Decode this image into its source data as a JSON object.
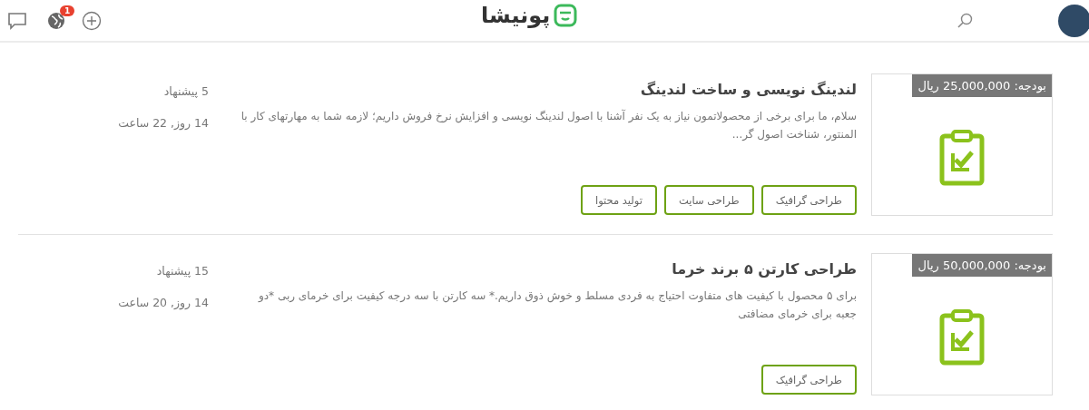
{
  "header": {
    "notification_count": "1",
    "logo": "پونیشا"
  },
  "projects": [
    {
      "budget": "بودجه: 25,000,000 ریال",
      "title": "لندینگ نویسی و ساخت لندینگ",
      "description": "سلام، ما برای برخی از محصولاتمون نیاز به یک نفر آشنا با اصول لندینگ نویسی و افزایش نرخ فروش داریم؛ لازمه شما به مهارتهای کار با المنتور، شناخت اصول گر...",
      "tags": [
        "طراحی گرافیک",
        "طراحی سایت",
        "تولید محتوا"
      ],
      "bids": "5 پیشنهاد",
      "time_left": "14 روز, 22 ساعت"
    },
    {
      "budget": "بودجه: 50,000,000 ریال",
      "title": "طراحی کارتن ۵ برند خرما",
      "description": "برای ۵ محصول با کیفیت های متفاوت احتیاج به فردی مسلط و خوش ذوق داریم.* سه کارتن با سه درجه کیفیت برای خرمای ربی *دو جعبه برای خرمای مضافتی",
      "tags": [
        "طراحی گرافیک"
      ],
      "bids": "15 پیشنهاد",
      "time_left": "14 روز, 20 ساعت"
    }
  ]
}
